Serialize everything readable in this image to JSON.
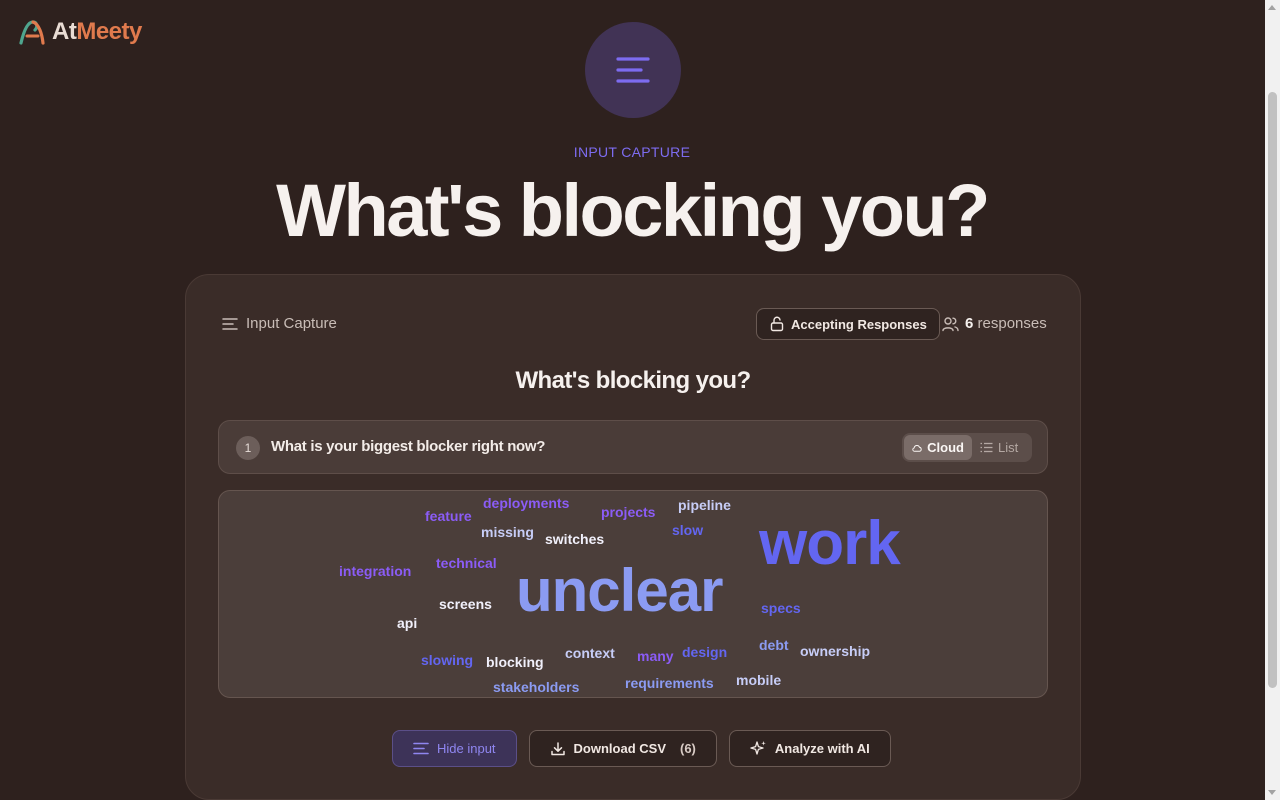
{
  "brand": {
    "part1": "At",
    "part2": "Meety"
  },
  "hero": {
    "kicker": "INPUT CAPTURE",
    "title": "What's blocking you?"
  },
  "card": {
    "header_label": "Input Capture",
    "status_label": "Accepting Responses",
    "responses_count": "6",
    "responses_label": "responses",
    "title": "What's blocking you?"
  },
  "question": {
    "number": "1",
    "text": "What is your biggest blocker right now?",
    "view_cloud": "Cloud",
    "view_list": "List"
  },
  "cloud_words": [
    "deployments",
    "feature",
    "projects",
    "pipeline",
    "missing",
    "switches",
    "slow",
    "work",
    "integration",
    "technical",
    "unclear",
    "screens",
    "specs",
    "api",
    "debt",
    "ownership",
    "context",
    "design",
    "many",
    "slowing",
    "blocking",
    "stakeholders",
    "requirements",
    "mobile"
  ],
  "actions": {
    "hide_input": "Hide input",
    "download_csv": "Download CSV",
    "download_count": "(6)",
    "analyze": "Analyze with AI"
  },
  "colors": {
    "background": "#2e211e",
    "accent": "#7d6cf0",
    "brand_orange": "#e07a4d",
    "card": "#3a2c28"
  }
}
